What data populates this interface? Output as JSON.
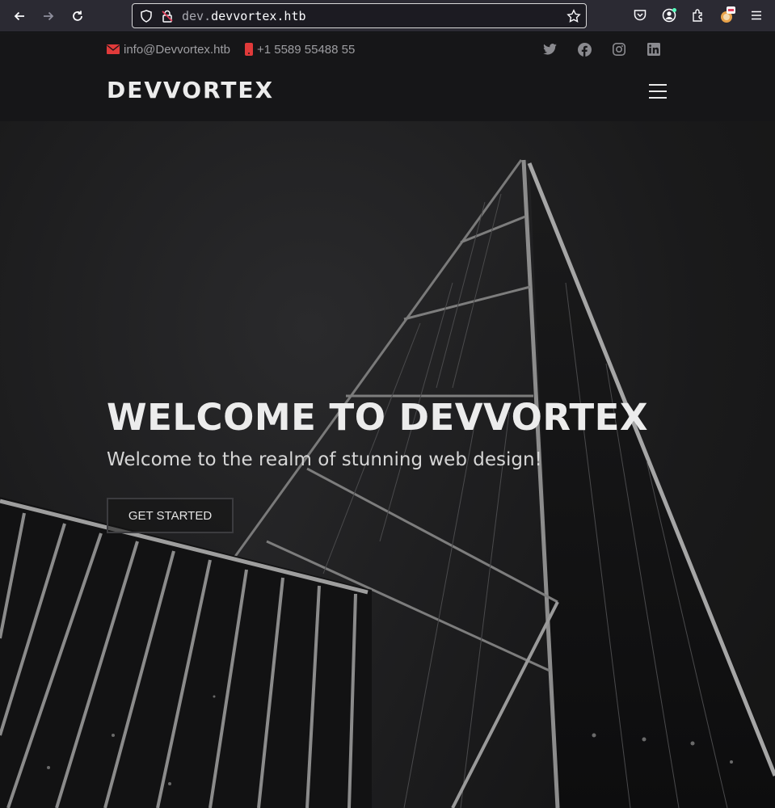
{
  "browser": {
    "url_prefix": "dev.",
    "url_host": "devvortex.htb"
  },
  "topbar": {
    "email": "info@Devvortex.htb",
    "phone": "+1 5589 55488 55",
    "socials": [
      "twitter-icon",
      "facebook-icon",
      "instagram-icon",
      "linkedin-icon"
    ]
  },
  "header": {
    "brand": "DEVVORTEX"
  },
  "hero": {
    "title": "WELCOME TO DEVVORTEX",
    "subtitle": "Welcome to the realm of stunning web design!",
    "cta_label": "GET STARTED"
  },
  "colors": {
    "accent": "#e03a3a",
    "header_bg": "#161618",
    "text_light": "#ececec"
  }
}
